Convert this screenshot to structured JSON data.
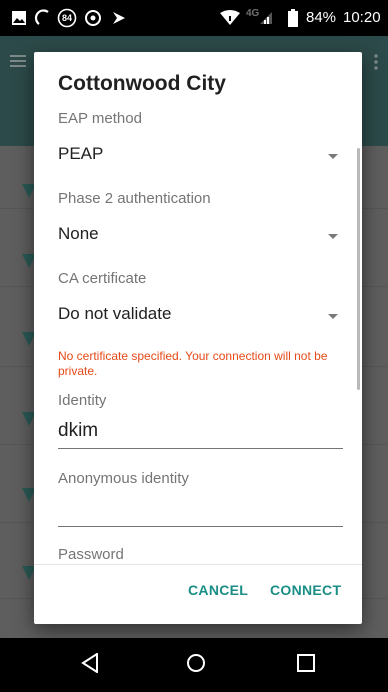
{
  "status_bar": {
    "badge_number": "84",
    "network_label": "4G",
    "battery_text": "84%",
    "time": "10:20"
  },
  "dialog": {
    "title": "Cottonwood City",
    "eap_method": {
      "label": "EAP method",
      "value": "PEAP"
    },
    "phase2": {
      "label": "Phase 2 authentication",
      "value": "None"
    },
    "ca_certificate": {
      "label": "CA certificate",
      "value": "Do not validate"
    },
    "warning": "No certificate specified. Your connection will not be private.",
    "identity": {
      "label": "Identity",
      "value": "dkim"
    },
    "anonymous_identity": {
      "label": "Anonymous identity",
      "value": ""
    },
    "password": {
      "label": "Password"
    },
    "cancel_label": "CANCEL",
    "connect_label": "CONNECT"
  },
  "colors": {
    "accent": "#1a8e85",
    "warning": "#e64a19",
    "toolbar_dimmed": "#2c4a49"
  }
}
